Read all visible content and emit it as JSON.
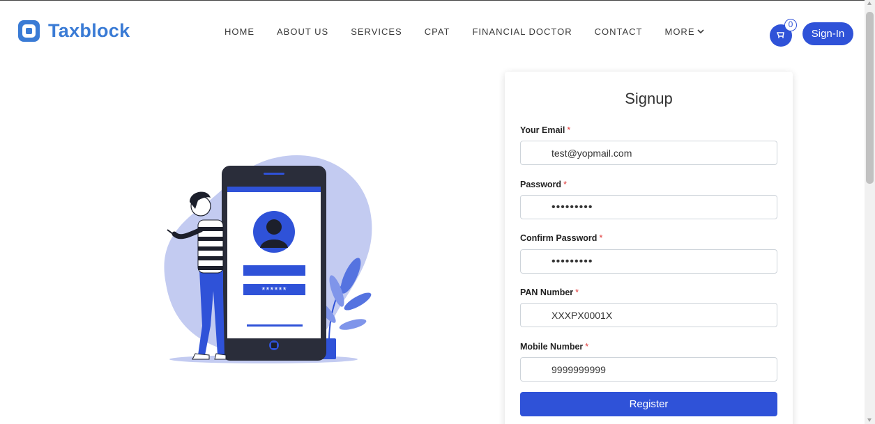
{
  "brand": {
    "name": "Taxblock",
    "color": "#3a7bd5"
  },
  "nav": {
    "items": [
      "HOME",
      "ABOUT US",
      "SERVICES",
      "CPAT",
      "FINANCIAL DOCTOR",
      "CONTACT"
    ],
    "more_label": "MORE"
  },
  "header": {
    "cart_count": "0",
    "signin_label": "Sign-In",
    "accent": "#2f52d8"
  },
  "illustration": {
    "password_mask": "******"
  },
  "signup": {
    "title": "Signup",
    "required_mark": "*",
    "fields": [
      {
        "label": "Your Email",
        "value": "test@yopmail.com",
        "type": "email"
      },
      {
        "label": "Password",
        "value": "•••••••••",
        "type": "password"
      },
      {
        "label": "Confirm Password",
        "value": "•••••••••",
        "type": "password"
      },
      {
        "label": "PAN Number",
        "value": "XXXPX0001X",
        "type": "text"
      },
      {
        "label": "Mobile Number",
        "value": "9999999999",
        "type": "tel"
      }
    ],
    "submit_label": "Register"
  }
}
